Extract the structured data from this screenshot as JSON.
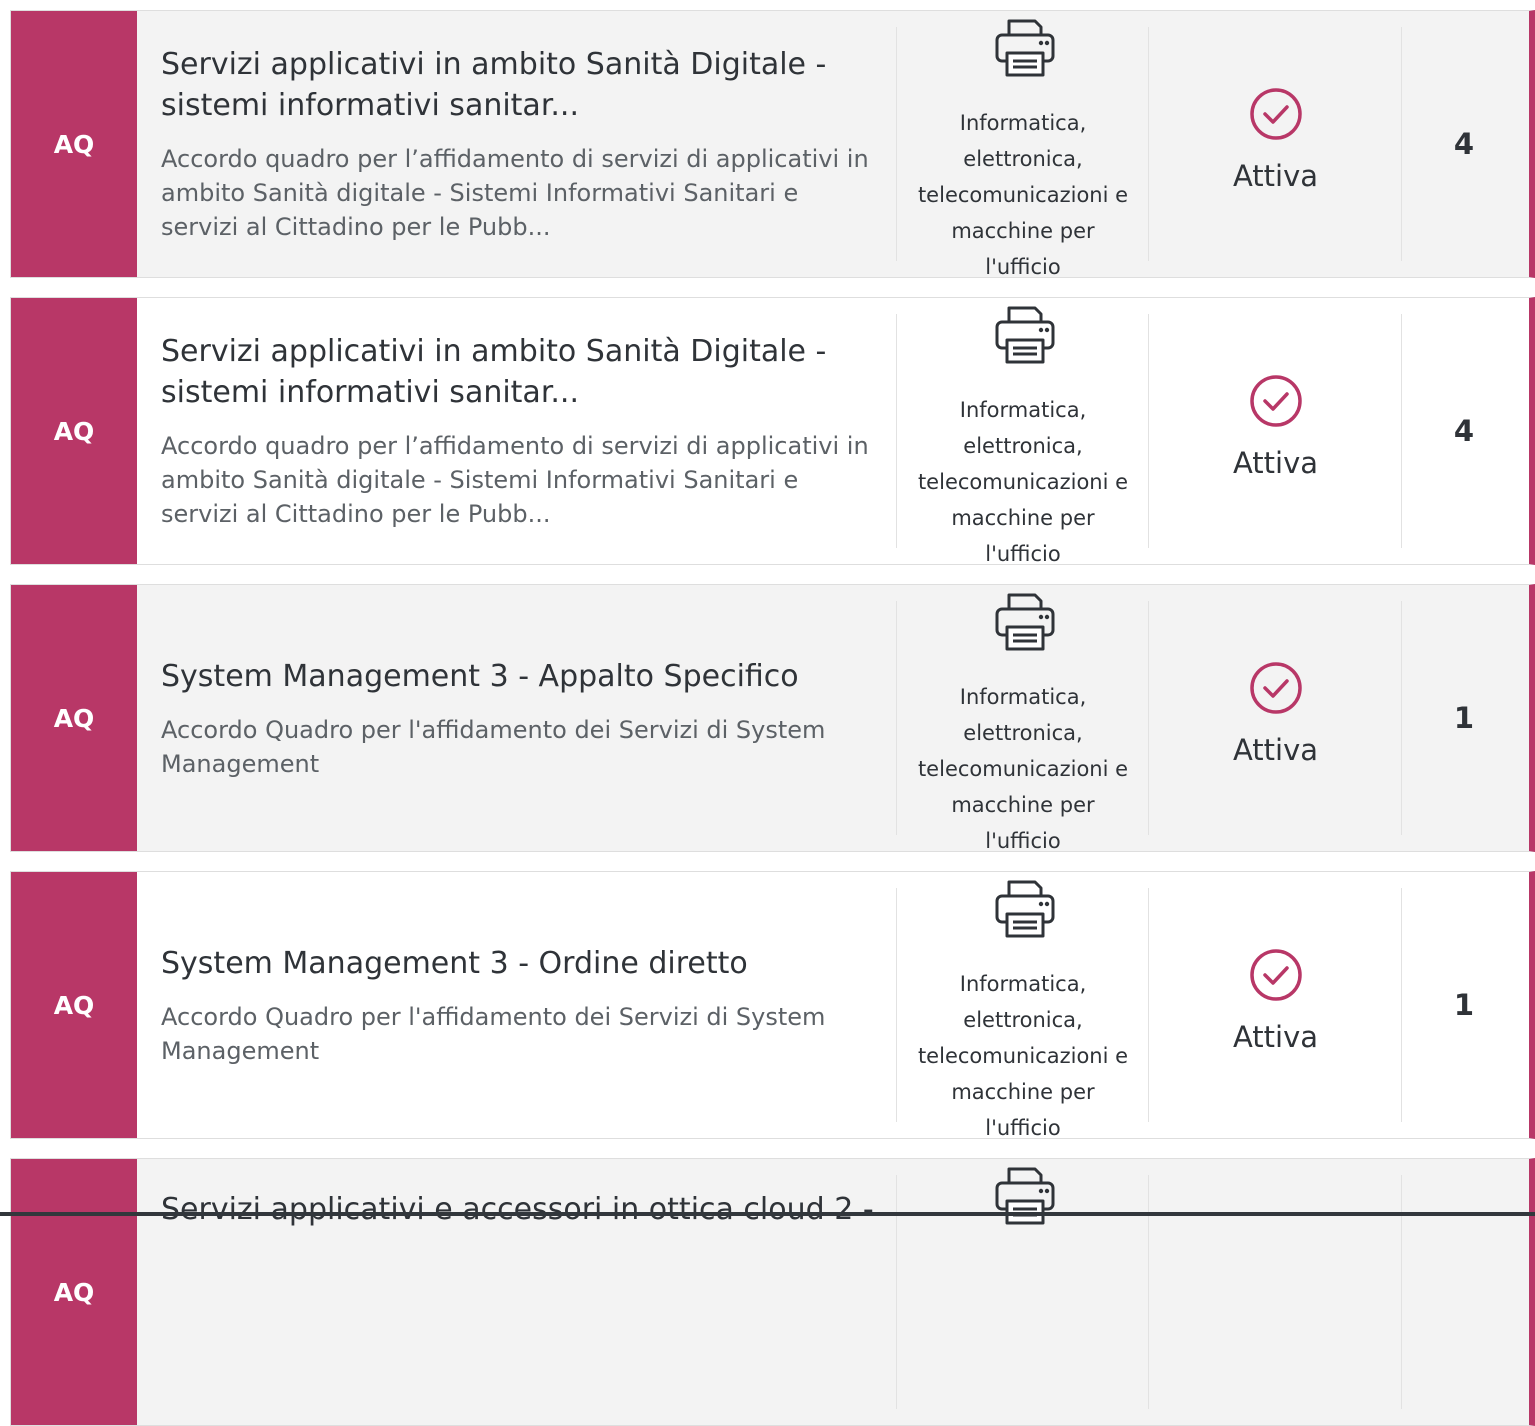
{
  "colors": {
    "accent": "#b83767",
    "text": "#2f3338",
    "muted": "#5c6166",
    "row_alt": "#f3f3f3"
  },
  "rows": [
    {
      "badge": "AQ",
      "title_lines": [
        "Servizi applicativi in ambito Sanità Digitale -",
        "sistemi informativi sanitar..."
      ],
      "desc_lines": [
        "Accordo quadro per l’affidamento di servizi di applicativi in",
        "ambito Sanità digitale - Sistemi Informativi Sanitari e",
        "servizi al Cittadino per le Pubb..."
      ],
      "category_icon": "printer-icon",
      "category_lines": [
        "Informatica,",
        "elettronica,",
        "telecomunicazioni e",
        "macchine per",
        "l'ufficio"
      ],
      "status_icon": "check-circle-icon",
      "status": "Attiva",
      "count": "4"
    },
    {
      "badge": "AQ",
      "title_lines": [
        "Servizi applicativi in ambito Sanità Digitale -",
        "sistemi informativi sanitar..."
      ],
      "desc_lines": [
        "Accordo quadro per l’affidamento di servizi di applicativi in",
        "ambito Sanità digitale - Sistemi Informativi Sanitari e",
        "servizi al Cittadino per le Pubb..."
      ],
      "category_icon": "printer-icon",
      "category_lines": [
        "Informatica,",
        "elettronica,",
        "telecomunicazioni e",
        "macchine per",
        "l'ufficio"
      ],
      "status_icon": "check-circle-icon",
      "status": "Attiva",
      "count": "4"
    },
    {
      "badge": "AQ",
      "title_lines": [
        "System Management 3 - Appalto Specifico"
      ],
      "desc_lines": [
        "Accordo Quadro per l'affidamento dei Servizi di System",
        "Management"
      ],
      "category_icon": "printer-icon",
      "category_lines": [
        "Informatica,",
        "elettronica,",
        "telecomunicazioni e",
        "macchine per",
        "l'ufficio"
      ],
      "status_icon": "check-circle-icon",
      "status": "Attiva",
      "count": "1"
    },
    {
      "badge": "AQ",
      "title_lines": [
        "System Management 3 - Ordine diretto"
      ],
      "desc_lines": [
        "Accordo Quadro per l'affidamento dei Servizi di System",
        "Management"
      ],
      "category_icon": "printer-icon",
      "category_lines": [
        "Informatica,",
        "elettronica,",
        "telecomunicazioni e",
        "macchine per",
        "l'ufficio"
      ],
      "status_icon": "check-circle-icon",
      "status": "Attiva",
      "count": "1"
    },
    {
      "badge": "AQ",
      "title_lines": [
        "Servizi applicativi e accessori in ottica cloud 2 -"
      ],
      "desc_lines": [],
      "category_icon": "printer-icon",
      "category_lines": [],
      "status_icon": "",
      "status": "",
      "count": ""
    }
  ]
}
